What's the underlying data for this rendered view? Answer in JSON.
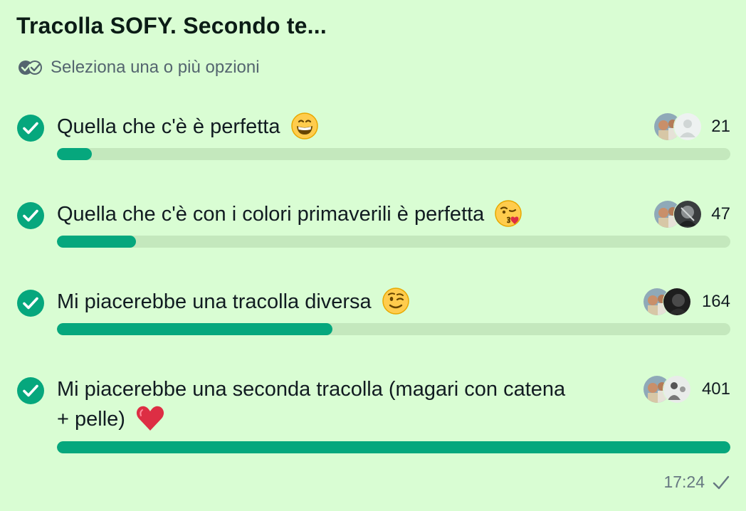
{
  "poll": {
    "title": "Tracolla SOFY. Secondo te...",
    "subtitle": "Seleziona una o più opzioni",
    "subtitle_icon": "double-check-icon",
    "options": [
      {
        "label": "Quella che c'è è perfetta",
        "emoji": "grinning-face-emoji",
        "count": "21",
        "share": 0.052,
        "checked": true
      },
      {
        "label": "Quella che c'è con i colori primaverili è perfetta",
        "emoji": "kissing-face-emoji",
        "count": "47",
        "share": 0.117,
        "checked": true
      },
      {
        "label": "Mi piacerebbe una tracolla diversa",
        "emoji": "winking-face-emoji",
        "count": "164",
        "share": 0.409,
        "checked": true
      },
      {
        "label_line1": "Mi piacerebbe una seconda tracolla (magari con catena",
        "label_line2": "+ pelle)",
        "emoji": "red-heart-emoji",
        "count": "401",
        "share": 1.0,
        "checked": true
      }
    ],
    "timestamp": "17:24",
    "status_icon": "sent-check-icon"
  },
  "colors": {
    "background": "#d9fdd3",
    "accent": "#06a77d",
    "track": "#c4e8bd",
    "text": "#111b21",
    "muted": "#667781"
  }
}
